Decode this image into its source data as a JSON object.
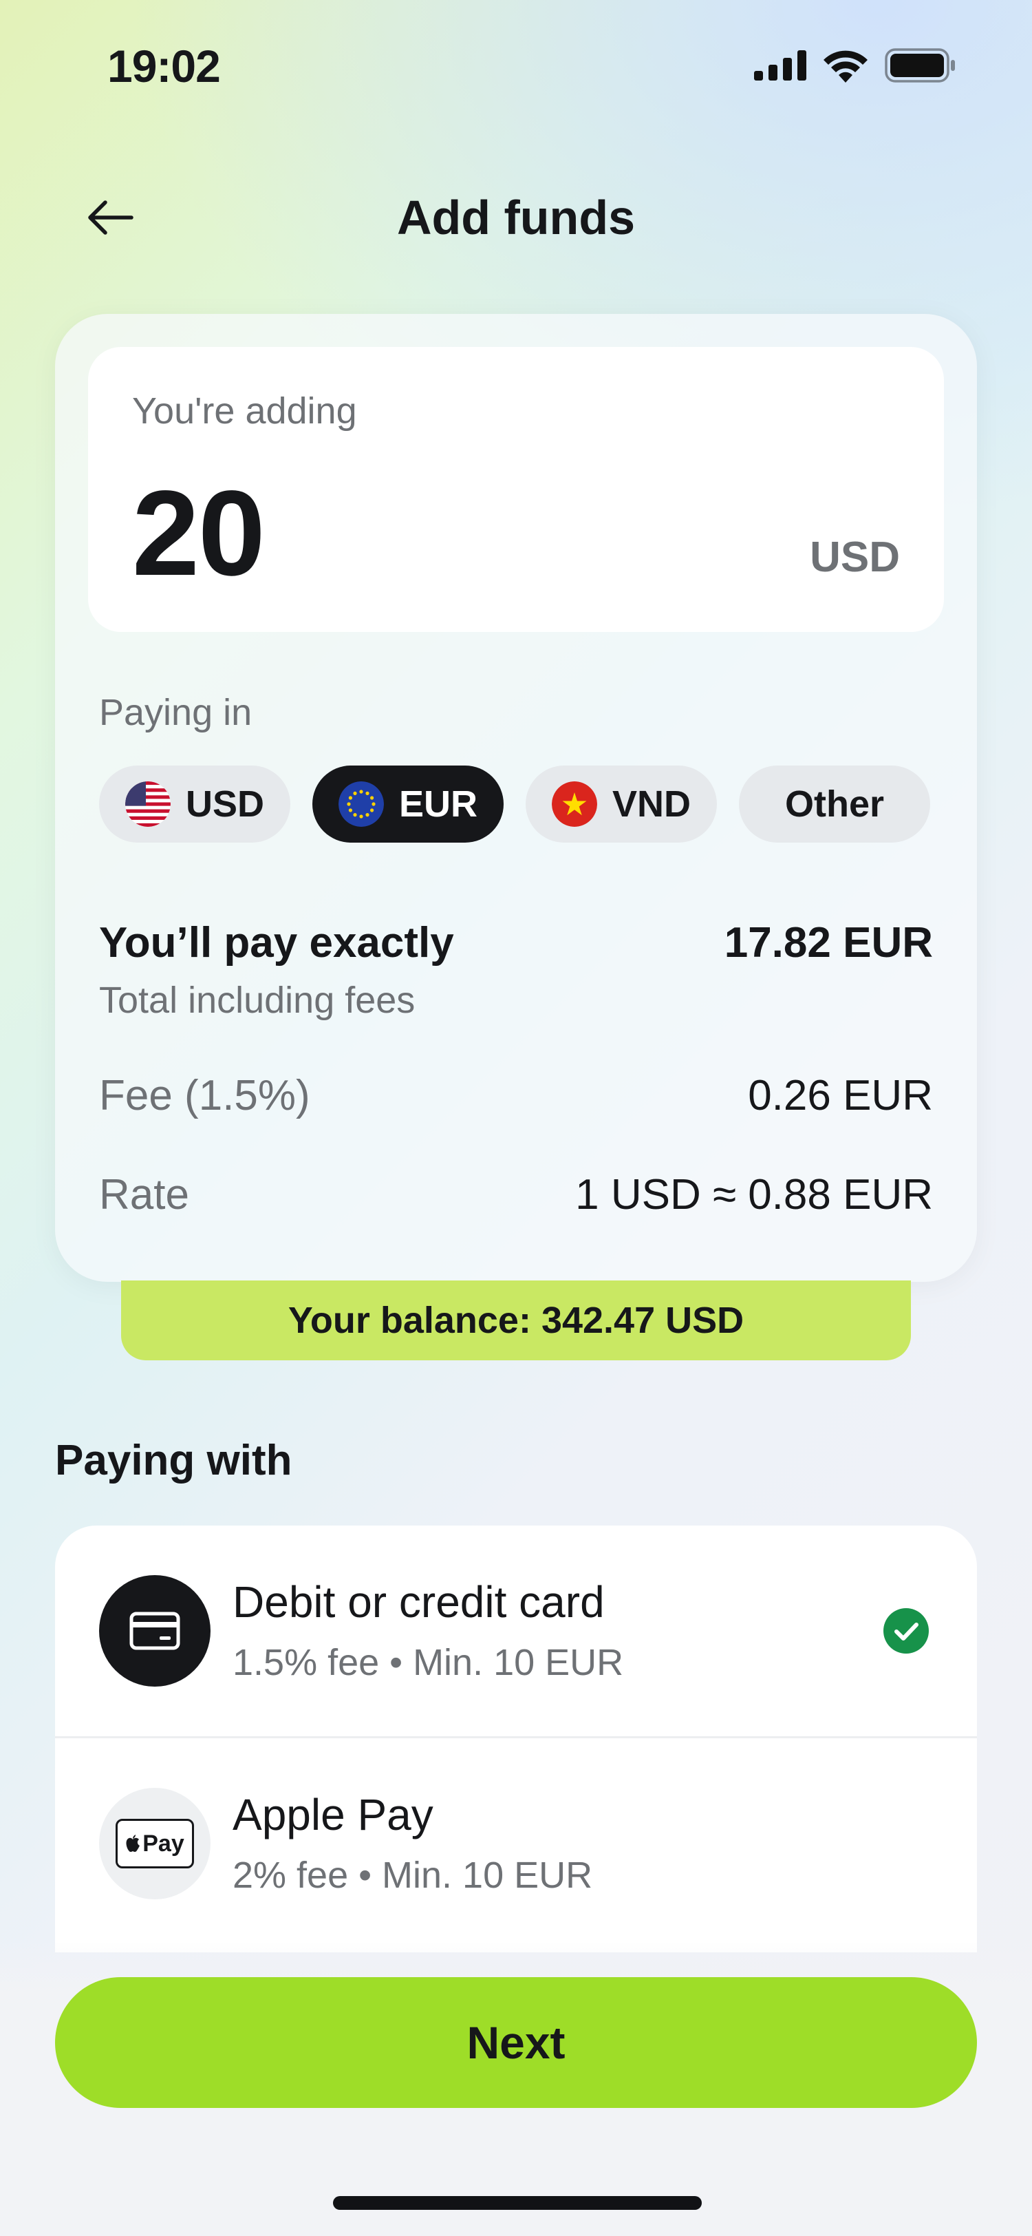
{
  "status_bar": {
    "time": "19:02",
    "icons": [
      "signal-icon",
      "wifi-icon",
      "battery-icon"
    ]
  },
  "header": {
    "back_icon": "arrow-left-icon",
    "title": "Add funds"
  },
  "amount": {
    "label": "You're adding",
    "value": "20",
    "currency": "USD"
  },
  "paying_in": {
    "label": "Paying in",
    "options": [
      {
        "code": "USD",
        "icon": "us-flag-icon",
        "selected": false
      },
      {
        "code": "EUR",
        "icon": "eu-flag-icon",
        "selected": true
      },
      {
        "code": "VND",
        "icon": "vn-flag-icon",
        "selected": false
      },
      {
        "code": "Other",
        "selected": false
      }
    ]
  },
  "summary": {
    "total_label": "You’ll pay exactly",
    "total_value": "17.82 EUR",
    "total_sub": "Total including fees",
    "fee_label": "Fee (1.5%)",
    "fee_value": "0.26 EUR",
    "rate_label": "Rate",
    "rate_value": "1 USD ≈ 0.88 EUR"
  },
  "balance": {
    "text": "Your balance: 342.47 USD"
  },
  "paying_with": {
    "title": "Paying with",
    "methods": [
      {
        "title": "Debit or credit card",
        "subtitle": "1.5% fee • Min. 10 EUR",
        "icon": "card-icon",
        "selected": true
      },
      {
        "title": "Apple Pay",
        "subtitle": "2% fee • Min. 10 EUR",
        "icon": "apple-pay-icon",
        "icon_text": "Pay",
        "selected": false
      }
    ]
  },
  "actions": {
    "next_label": "Next"
  },
  "colors": {
    "accent": "#9edd28",
    "balance_strip": "#c9e863",
    "selected_chip": "#16171a",
    "check": "#17924a"
  }
}
